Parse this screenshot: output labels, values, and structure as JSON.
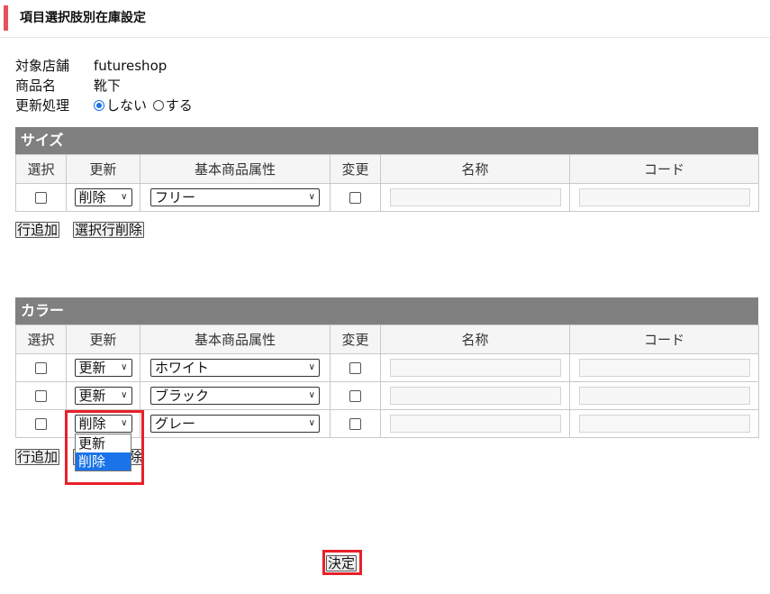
{
  "header": {
    "title": "項目選択肢別在庫設定"
  },
  "info": {
    "store_label": "対象店舗",
    "store_value": "futureshop",
    "product_label": "商品名",
    "product_value": "靴下",
    "update_label": "更新処理",
    "radio_no": "しない",
    "radio_yes": "する"
  },
  "columns": [
    "選択",
    "更新",
    "基本商品属性",
    "変更",
    "名称",
    "コード"
  ],
  "size": {
    "title": "サイズ",
    "rows": [
      {
        "update": "削除",
        "attr": "フリー"
      }
    ]
  },
  "color": {
    "title": "カラー",
    "rows": [
      {
        "update": "更新",
        "attr": "ホワイト"
      },
      {
        "update": "更新",
        "attr": "ブラック"
      },
      {
        "update": "削除",
        "attr": "グレー"
      }
    ]
  },
  "buttons": {
    "add_row": "行追加",
    "delete_selected": "選択行削除",
    "decide": "決定"
  },
  "dropdown": {
    "options": [
      "更新",
      "削除"
    ],
    "selected_index": 1
  },
  "colors": {
    "accent": "#e8505b",
    "section_header": "#808080",
    "highlight": "#e8202a",
    "selection": "#1a73e8"
  }
}
